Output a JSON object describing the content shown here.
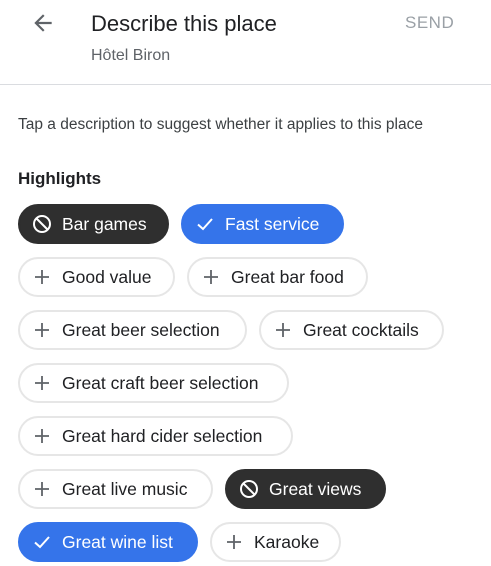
{
  "header": {
    "title": "Describe this place",
    "subtitle": "Hôtel Biron",
    "send_label": "SEND"
  },
  "instruction": "Tap a description to suggest whether it applies to this place",
  "highlights": {
    "title": "Highlights",
    "chips": [
      {
        "label": "Bar games",
        "state": "excluded",
        "icon": "block-icon"
      },
      {
        "label": "Fast service",
        "state": "selected",
        "icon": "check-icon"
      },
      {
        "label": "Good value",
        "state": "unselected",
        "icon": "plus-icon"
      },
      {
        "label": "Great bar food",
        "state": "unselected",
        "icon": "plus-icon"
      },
      {
        "label": "Great beer selection",
        "state": "unselected",
        "icon": "plus-icon"
      },
      {
        "label": "Great cocktails",
        "state": "unselected",
        "icon": "plus-icon"
      },
      {
        "label": "Great craft beer selection",
        "state": "unselected",
        "icon": "plus-icon"
      },
      {
        "label": "Great hard cider selection",
        "state": "unselected",
        "icon": "plus-icon"
      },
      {
        "label": "Great live music",
        "state": "unselected",
        "icon": "plus-icon"
      },
      {
        "label": "Great views",
        "state": "excluded",
        "icon": "block-icon"
      },
      {
        "label": "Great wine list",
        "state": "selected",
        "icon": "check-icon"
      },
      {
        "label": "Karaoke",
        "state": "unselected",
        "icon": "plus-icon"
      }
    ]
  },
  "colors": {
    "selected": "#3574ea",
    "excluded": "#2f2f2f",
    "chip_border": "#e6e6e6",
    "send_disabled": "#9aa0a6"
  }
}
